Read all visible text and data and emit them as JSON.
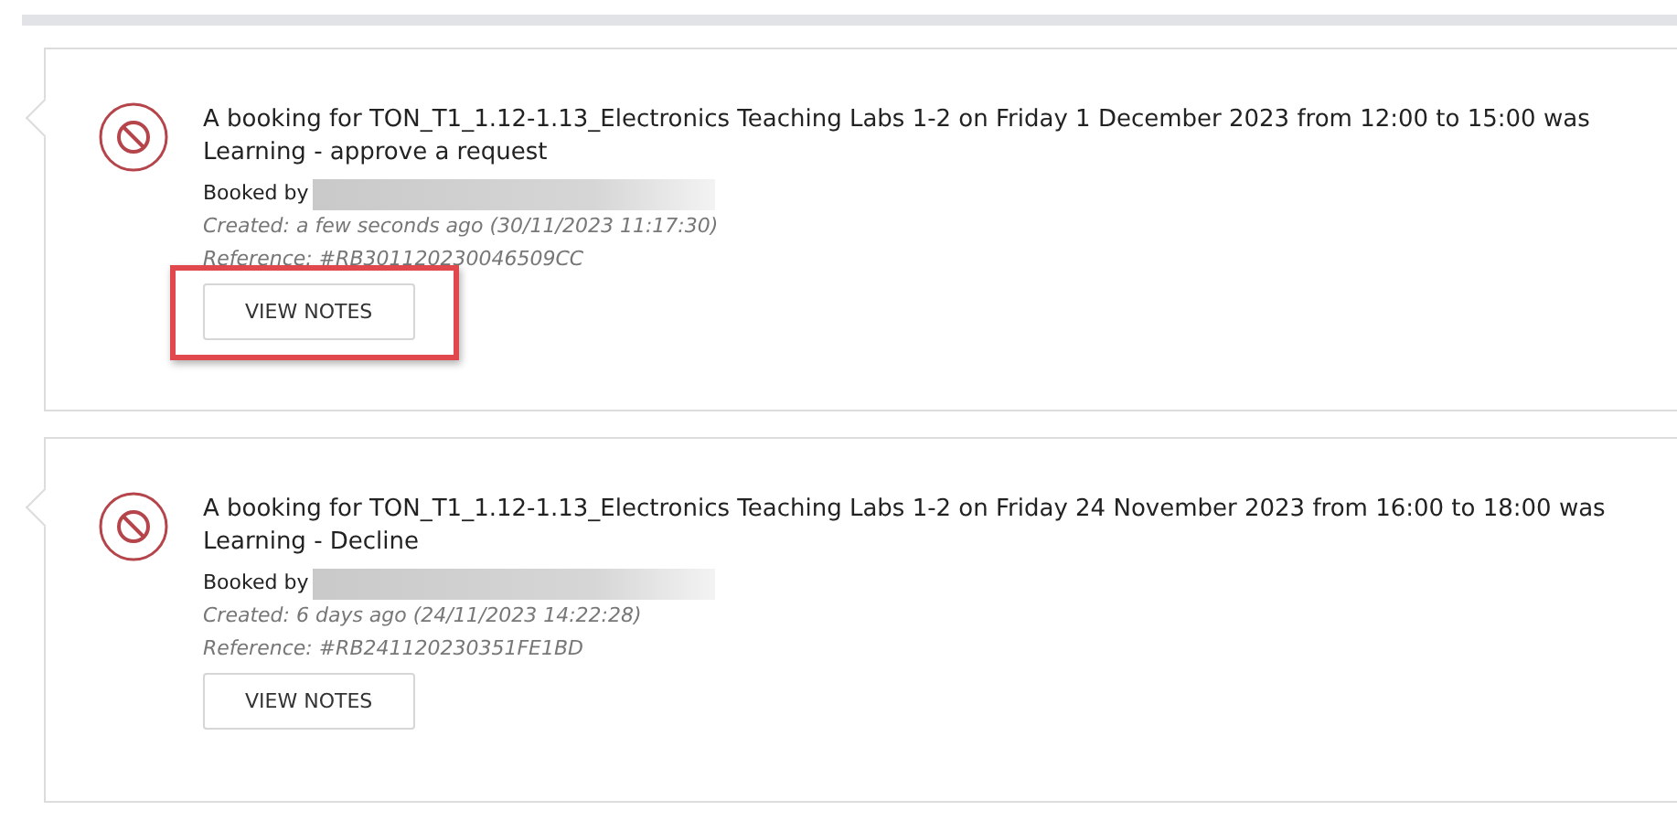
{
  "notifications": [
    {
      "message": "A booking for TON_T1_1.12-1.13_Electronics Teaching Labs 1-2 on Friday 1 December 2023 from 12:00 to 15:00 was",
      "subtitle": "Learning - approve a request",
      "booked_by": "Booked by",
      "created": "Created: a few seconds ago (30/11/2023 11:17:30)",
      "reference": "Reference: #RB301120230046509CC",
      "button": "VIEW NOTES",
      "highlighted": true
    },
    {
      "message": "A booking for TON_T1_1.12-1.13_Electronics Teaching Labs 1-2 on Friday 24 November 2023 from 16:00 to 18:00 was",
      "subtitle": "Learning - Decline",
      "booked_by": "Booked by",
      "created": "Created: 6 days ago (24/11/2023 14:22:28)",
      "reference": "Reference: #RB241120230351FE1BD",
      "button": "VIEW NOTES",
      "highlighted": false
    }
  ]
}
